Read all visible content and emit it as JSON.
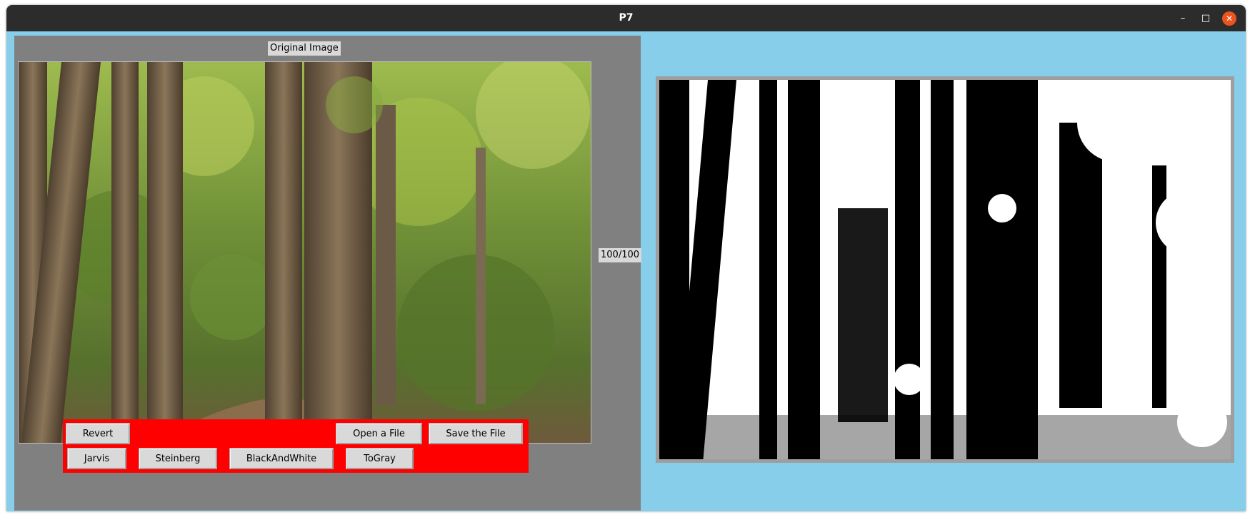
{
  "window": {
    "title": "P7",
    "controls": {
      "minimize": "–",
      "maximize": "□",
      "close": "✕"
    }
  },
  "left_panel": {
    "original_label": "Original Image",
    "slider_value": "100/100"
  },
  "buttons": {
    "revert": "Revert",
    "open_file": "Open a File",
    "save_file": "Save the File",
    "jarvis": "Jarvis",
    "steinberg": "Steinberg",
    "black_and_white": "BlackAndWhite",
    "to_gray": "ToGray"
  },
  "colors": {
    "window_bg": "#87ceeb",
    "panel_bg": "#808080",
    "button_panel": "#ff0000",
    "close_button": "#e95420"
  },
  "images": {
    "original": "forest photograph with tall tree trunks and a dirt path",
    "result": "black and white dithered version of the forest photograph"
  }
}
